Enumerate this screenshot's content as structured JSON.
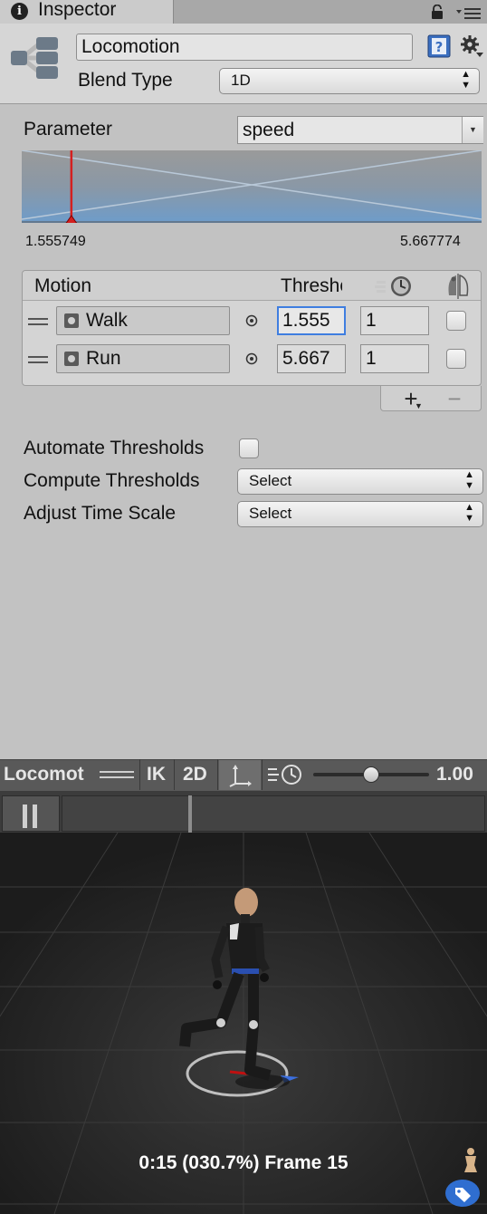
{
  "tab": {
    "title": "Inspector"
  },
  "header": {
    "name": "Locomotion",
    "blend_type_label": "Blend Type",
    "blend_type_value": "1D"
  },
  "parameter": {
    "label": "Parameter",
    "value": "speed",
    "min_value": "1.555749",
    "max_value": "5.667774",
    "marker_value": 1.555749
  },
  "motions": {
    "column_motion": "Motion",
    "column_threshold": "Threshold",
    "rows": [
      {
        "name": "Walk",
        "threshold": "1.555",
        "speed": "1"
      },
      {
        "name": "Run",
        "threshold": "5.667",
        "speed": "1"
      }
    ]
  },
  "options": {
    "automate_label": "Automate Thresholds",
    "compute_label": "Compute Thresholds",
    "compute_value": "Select",
    "adjust_label": "Adjust Time Scale",
    "adjust_value": "Select"
  },
  "preview_toolbar": {
    "clip": "Locomot",
    "ik": "IK",
    "mode_2d": "2D",
    "speed": "1.00",
    "speed_level": 0.5
  },
  "viewport": {
    "readout": "0:15 (030.7%) Frame 15"
  },
  "colors": {
    "accent_blue": "#3f7ee0",
    "graph_fill": "#7ba3c9",
    "marker_red": "#d42020"
  }
}
